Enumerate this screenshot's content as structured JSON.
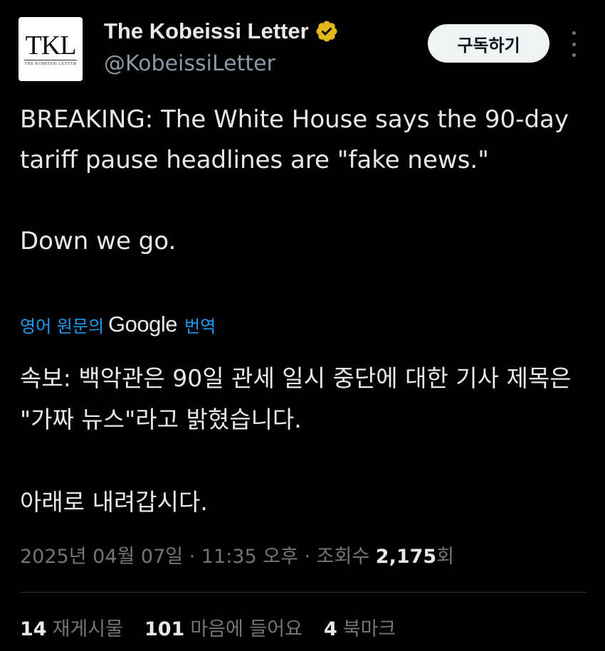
{
  "author": {
    "avatar_logo": "TKL",
    "avatar_subtitle": "THE KOBEISSI LETTER",
    "display_name": "The Kobeissi Letter",
    "handle": "@KobeissiLetter",
    "verified_icon": "verified-badge-gold",
    "verified_color": "#e2b719"
  },
  "header": {
    "subscribe_label": "구독하기",
    "more_icon": "more-vertical-icon"
  },
  "tweet": {
    "text": "BREAKING: The White House says the 90-day tariff pause headlines are \"fake news.\"\n\nDown we go."
  },
  "translation": {
    "prefix": "영어 원문의",
    "google": "Google",
    "suffix": "번역",
    "text": "속보: 백악관은 90일 관세 일시 중단에 대한 기사 제목은 \"가짜 뉴스\"라고 밝혔습니다.\n\n아래로 내려갑시다."
  },
  "meta": {
    "datetime": "2025년 04월 07일 · 11:35 오후 · 조회수 ",
    "views": "2,175",
    "views_suffix": "회"
  },
  "stats": {
    "reposts_count": "14",
    "reposts_label": "재게시물",
    "likes_count": "101",
    "likes_label": "마음에 들어요",
    "bookmarks_count": "4",
    "bookmarks_label": "북마크"
  },
  "colors": {
    "background": "#000000",
    "text": "#e7e9ea",
    "secondary": "#71767b",
    "link": "#1d9bf0"
  }
}
